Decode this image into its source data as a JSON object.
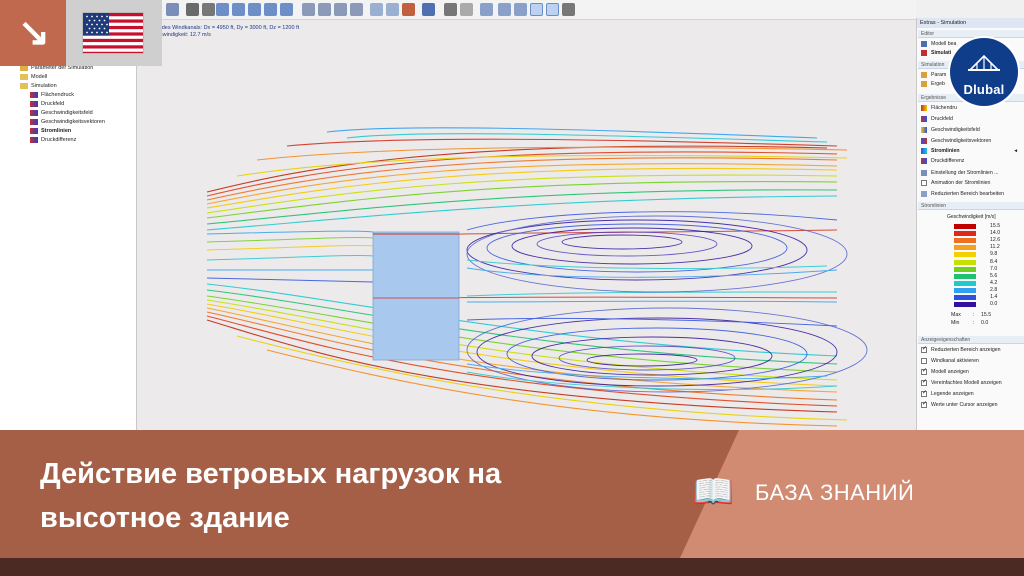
{
  "tree": {
    "items": [
      {
        "label": "Parameter der Simulation",
        "bold": false
      },
      {
        "label": "Modell",
        "bold": false
      },
      {
        "label": "Simulation",
        "bold": false
      },
      {
        "label": "Flächendruck",
        "bold": false
      },
      {
        "label": "Druckfeld",
        "bold": false
      },
      {
        "label": "Geschwindigkeitsfeld",
        "bold": false
      },
      {
        "label": "Geschwindigkeitsvektoren",
        "bold": false
      },
      {
        "label": "Stromlinien",
        "bold": true
      },
      {
        "label": "Druckdifferenz",
        "bold": false
      }
    ]
  },
  "viewport": {
    "info_line1": "nen des Windkanals: Dx = 4950 ft, Dy = 3000 ft, Dz = 1200 ft",
    "info_line2": "eschwindigkeit: 12.7 m/s"
  },
  "panel": {
    "title": "Extras - Simulation",
    "sec_editor": "Editor",
    "editor_items": [
      "Modell bea",
      "Simulati"
    ],
    "sec_simulation": "Simulation",
    "simulation_items": [
      "Param",
      "Ergeb"
    ],
    "sec_results": "Ergebnisse",
    "result_items": [
      "Flächendru",
      "Druckfeld",
      "Geschwindigkeitsfeld",
      "Geschwindigkeitsvektoren",
      "Stromlinien",
      "Druckdifferenz"
    ],
    "extra_items": [
      "Einstellung der Stromlinien ...",
      "Animation der Stromlinien",
      "Reduzierten Bereich bearbeiten"
    ],
    "sec_streamlines": "Stromlinien",
    "legend_title": "Geschwindigkeit [m/s]",
    "legend": [
      {
        "value": "15.5",
        "color": "#c00000"
      },
      {
        "value": "14.0",
        "color": "#e0281a"
      },
      {
        "value": "12.6",
        "color": "#f07020"
      },
      {
        "value": "11.2",
        "color": "#f5a020"
      },
      {
        "value": "9.8",
        "color": "#f5d000"
      },
      {
        "value": "8.4",
        "color": "#c8e000"
      },
      {
        "value": "7.0",
        "color": "#70d020"
      },
      {
        "value": "5.6",
        "color": "#20c070"
      },
      {
        "value": "4.2",
        "color": "#20c8d0"
      },
      {
        "value": "2.8",
        "color": "#30a0f0"
      },
      {
        "value": "1.4",
        "color": "#3050e0"
      },
      {
        "value": "0.0",
        "color": "#3010a0"
      }
    ],
    "max_label": "Max",
    "max_value": "15.5",
    "min_label": "Min",
    "min_value": "0.0",
    "sec_display": "Anzeigeeigenschaften",
    "checkboxes": [
      {
        "label": "Reduzierten Bereich anzeigen",
        "checked": true
      },
      {
        "label": "Windkanal aktivieren",
        "checked": false
      },
      {
        "label": "Modell anzeigen",
        "checked": true
      },
      {
        "label": "Vereinfachtes Modell anzeigen",
        "checked": true
      },
      {
        "label": "Legende anzeigen",
        "checked": true
      },
      {
        "label": "Werte unter Cursor anzeigen",
        "checked": true
      }
    ]
  },
  "logo": {
    "text": "Dlubal"
  },
  "banner": {
    "title_line1": "Действие ветровых нагрузок на",
    "title_line2": "высотное здание",
    "kb_label": "БАЗА ЗНАНИЙ"
  },
  "colors": {
    "banner_dark": "#a65f47",
    "banner_light": "#d08b72",
    "accent": "#c0694f",
    "logo_blue": "#0f3d8a",
    "building": "#a9c8ee"
  }
}
